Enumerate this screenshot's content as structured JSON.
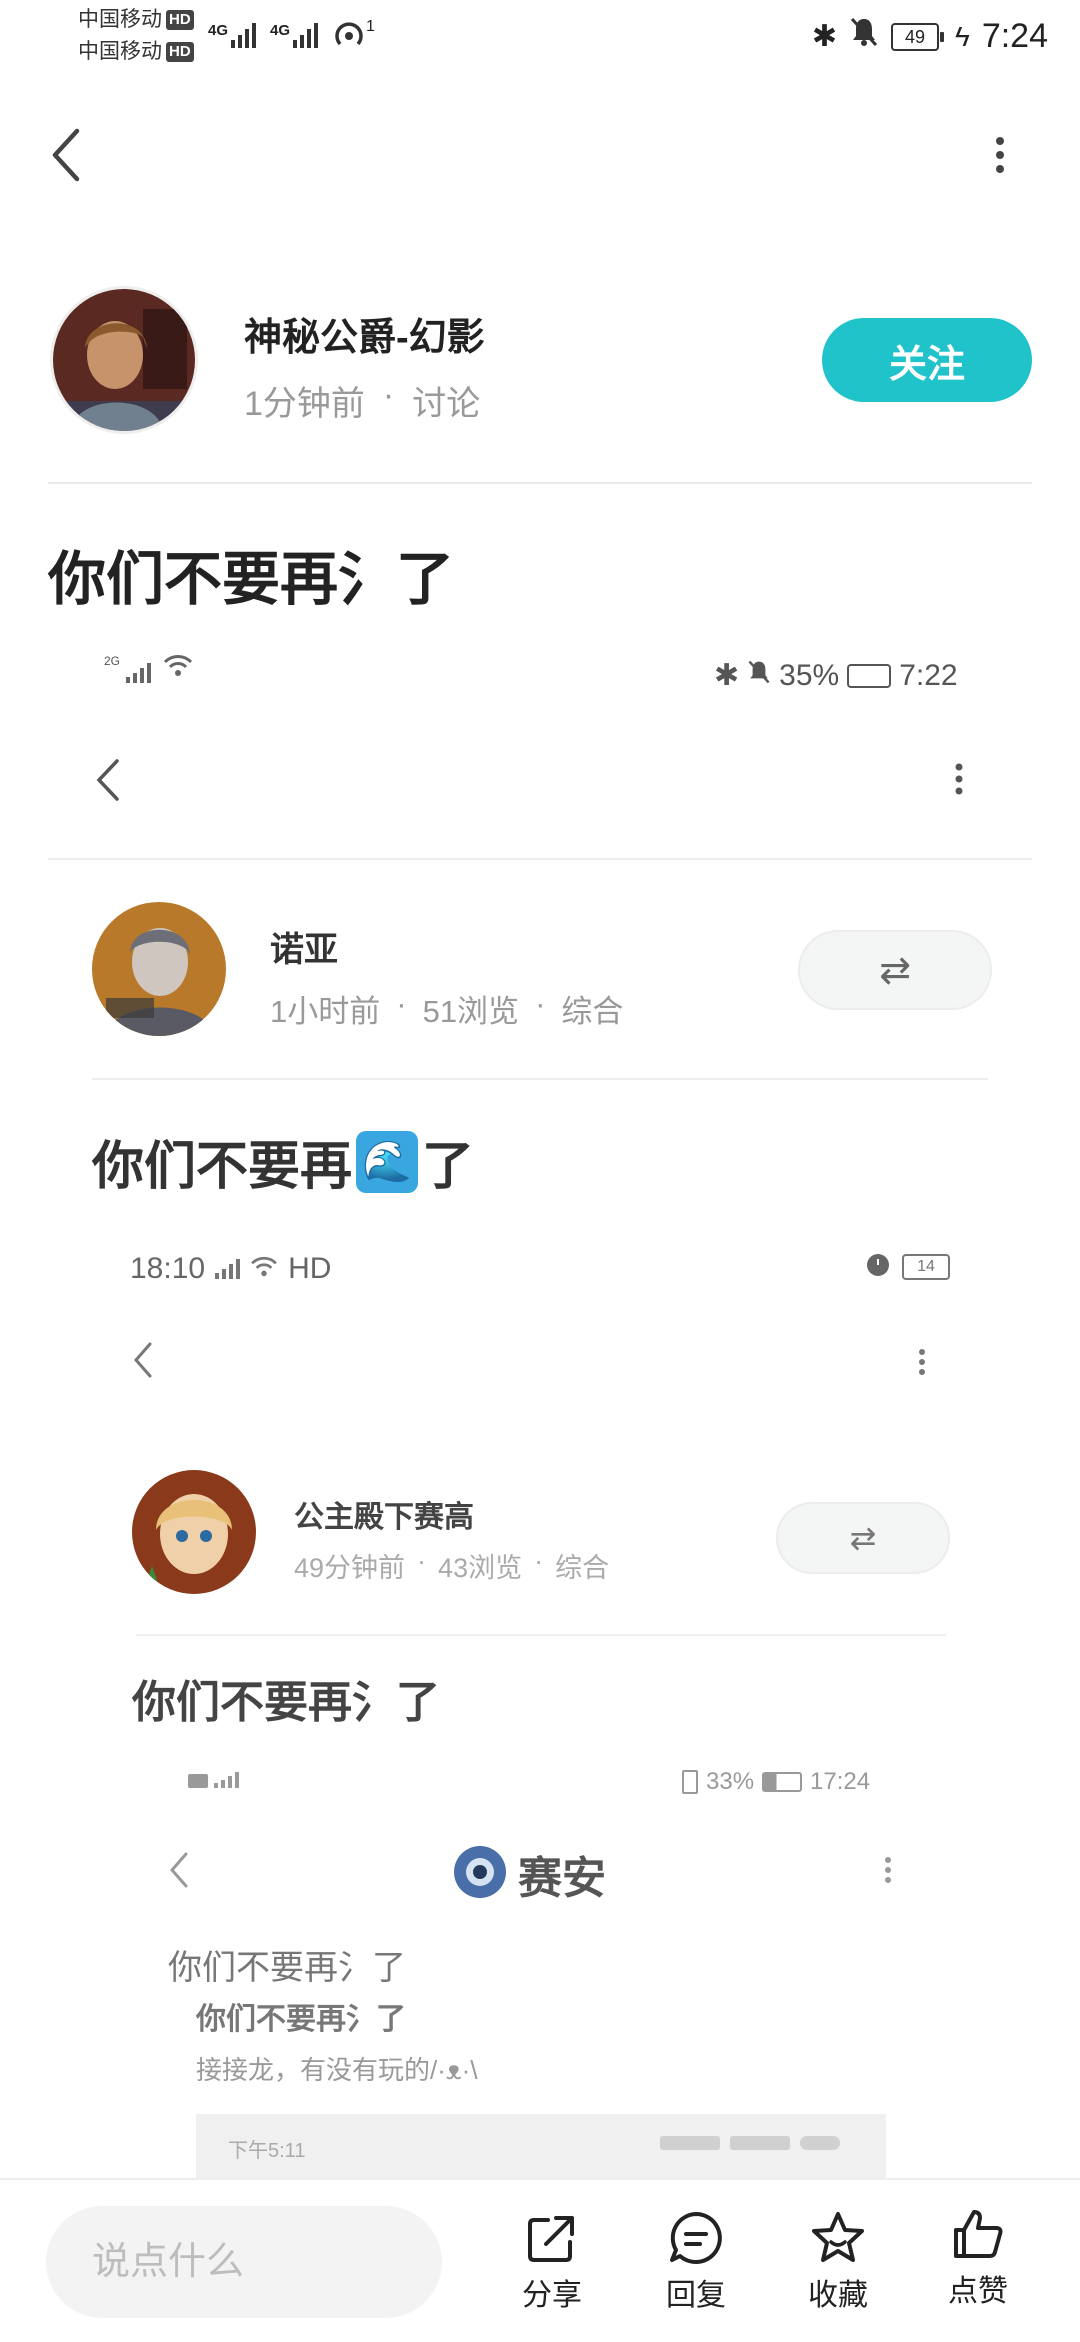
{
  "status_bar": {
    "carrier1": "中国移动",
    "carrier2": "中国移动",
    "hd": "HD",
    "net1": "4G",
    "net2": "4G",
    "hotspot_count": "1",
    "battery": "49",
    "time": "7:24"
  },
  "post": {
    "author": "神秘公爵-幻影",
    "time": "1分钟前",
    "separator": "·",
    "category": "讨论",
    "follow_label": "关注",
    "title": "你们不要再氵了"
  },
  "nested1": {
    "net": "2G",
    "battery": "35%",
    "time": "7:22",
    "author": "诺亚",
    "time_ago": "1小时前",
    "views": "51浏览",
    "category": "综合",
    "title_a": "你们不要再",
    "title_emoji": "🌊",
    "title_b": "了",
    "swap": "⇄"
  },
  "nested2": {
    "time": "18:10",
    "hd": "HD",
    "battery": "14",
    "author": "公主殿下赛高",
    "time_ago": "49分钟前",
    "views": "43浏览",
    "category": "综合",
    "title": "你们不要再氵了",
    "swap": "⇄"
  },
  "nested3": {
    "battery": "33%",
    "time": "17:24",
    "app_name": "赛安",
    "line1": "你们不要再氵了",
    "line2": "你们不要再氵了",
    "line3": "接接龙，有没有玩的/·ᴥ·\\",
    "inner_time": "下午5:11"
  },
  "bottom_bar": {
    "placeholder": "说点什么",
    "share": "分享",
    "reply": "回复",
    "favorite": "收藏",
    "like": "点赞"
  },
  "colors": {
    "accent": "#1fc3c9",
    "text": "#222222",
    "secondary": "#888888"
  }
}
